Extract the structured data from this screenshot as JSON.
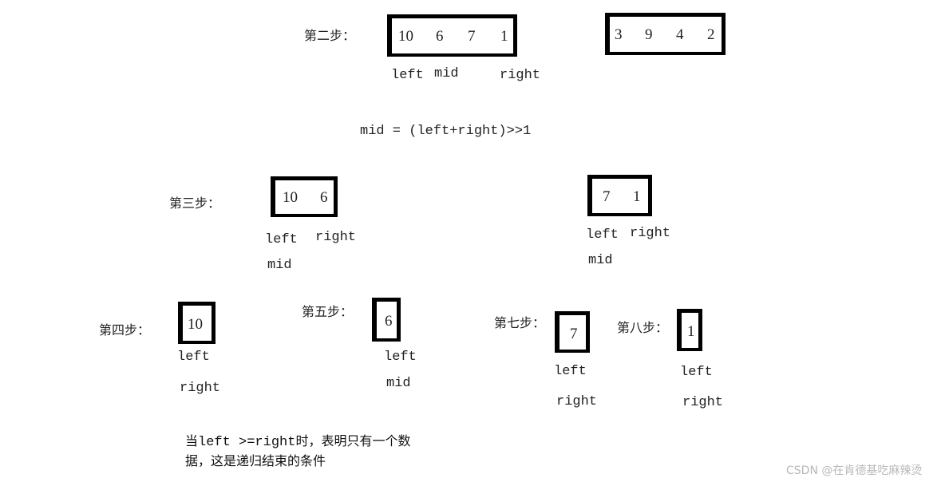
{
  "steps": {
    "step2": {
      "title": "第二步：",
      "left_array": [
        "10",
        "6",
        "7",
        "1"
      ],
      "right_array": [
        "3",
        "9",
        "4",
        "2"
      ],
      "pointers": {
        "left": "left",
        "mid": "mid",
        "right": "right"
      }
    },
    "formula": "mid = (left+right)>>1",
    "step3": {
      "title": "第三步：",
      "left_array": [
        "10",
        "6"
      ],
      "left_pointers": {
        "left": "left",
        "right": "right",
        "mid": "mid"
      },
      "right_array": [
        "7",
        "1"
      ],
      "right_pointers": {
        "left": "left",
        "right": "right",
        "mid": "mid"
      }
    },
    "step4": {
      "title": "第四步：",
      "array": [
        "10"
      ],
      "pointers": {
        "left": "left",
        "right": "right"
      }
    },
    "step5": {
      "title": "第五步：",
      "array": [
        "6"
      ],
      "pointers": {
        "left": "left",
        "mid": "mid"
      }
    },
    "step7": {
      "title": "第七步：",
      "array": [
        "7"
      ],
      "pointers": {
        "left": "left",
        "right": "right"
      }
    },
    "step8": {
      "title": "第八步：",
      "array": [
        "1"
      ],
      "pointers": {
        "left": "left",
        "right": "right"
      }
    }
  },
  "note": {
    "prefix": "当",
    "condition": "left >=right",
    "line1_rest": "时，表明只有一个数",
    "line2": "据，这是递归结束的条件"
  },
  "watermark": "CSDN @在肯德基吃麻辣烫"
}
